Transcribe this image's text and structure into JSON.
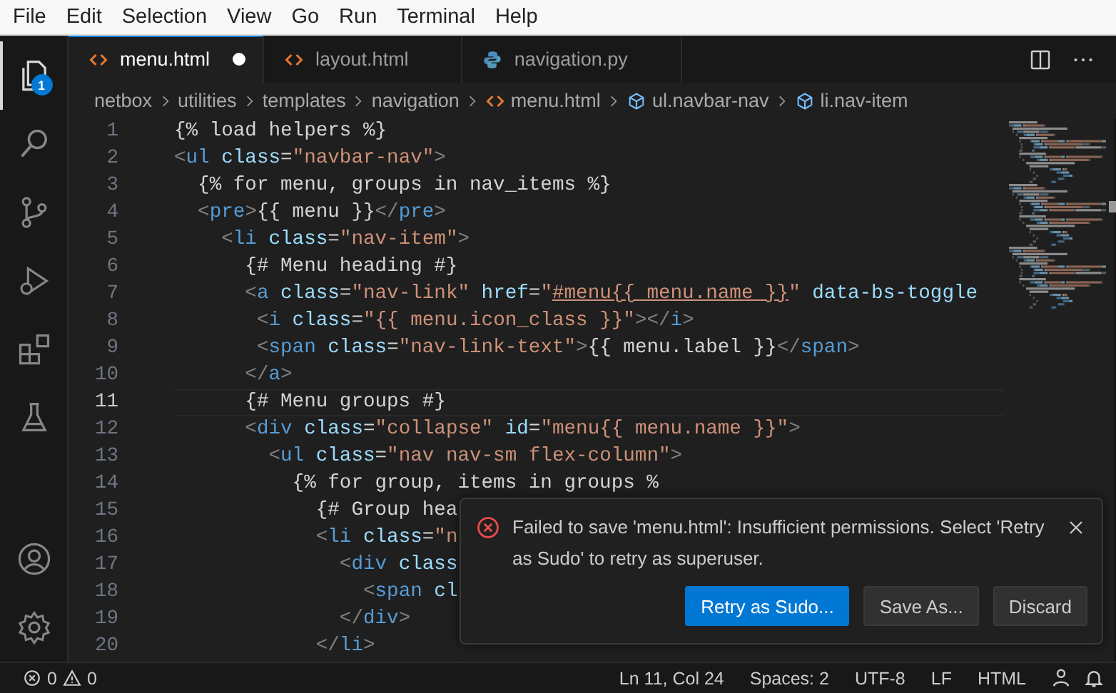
{
  "menu_bar": [
    "File",
    "Edit",
    "Selection",
    "View",
    "Go",
    "Run",
    "Terminal",
    "Help"
  ],
  "activity_bar": [
    {
      "kind": "explorer",
      "selected": true,
      "badge": "1"
    },
    {
      "kind": "search",
      "selected": false
    },
    {
      "kind": "source-control",
      "selected": false
    },
    {
      "kind": "run-debug",
      "selected": false
    },
    {
      "kind": "extensions",
      "selected": false
    },
    {
      "kind": "testing",
      "selected": false
    },
    {
      "kind": "account",
      "selected": false
    },
    {
      "kind": "settings",
      "selected": false
    }
  ],
  "tabs": [
    {
      "label": "menu.html",
      "kind": "html",
      "selected": true,
      "modified": true
    },
    {
      "label": "layout.html",
      "kind": "html",
      "selected": false,
      "modified": false
    },
    {
      "label": "navigation.py",
      "kind": "python",
      "selected": false,
      "modified": false
    }
  ],
  "breadcrumbs": [
    {
      "label": "netbox",
      "kind": "folder"
    },
    {
      "label": "utilities",
      "kind": "folder"
    },
    {
      "label": "templates",
      "kind": "folder"
    },
    {
      "label": "navigation",
      "kind": "folder"
    },
    {
      "label": "menu.html",
      "kind": "html"
    },
    {
      "label": "ul.navbar-nav",
      "kind": "symbol"
    },
    {
      "label": "li.nav-item",
      "kind": "symbol"
    }
  ],
  "editor": {
    "lines": [
      {
        "number": "1",
        "current": false,
        "tokens": [
          {
            "kind": "text",
            "text": "{% load helpers %}"
          }
        ]
      },
      {
        "number": "2",
        "current": false,
        "tokens": [
          {
            "kind": "punct",
            "text": "<"
          },
          {
            "kind": "tag",
            "text": "ul"
          },
          {
            "kind": "attr",
            "text": " class"
          },
          {
            "kind": "text",
            "text": "="
          },
          {
            "kind": "str",
            "text": "\"navbar-nav\""
          },
          {
            "kind": "punct",
            "text": ">"
          }
        ]
      },
      {
        "number": "3",
        "current": false,
        "tokens": [
          {
            "kind": "text",
            "text": "  {% for menu, groups in nav_items %}"
          }
        ]
      },
      {
        "number": "4",
        "current": false,
        "tokens": [
          {
            "kind": "punct",
            "text": "  <"
          },
          {
            "kind": "tag",
            "text": "pre"
          },
          {
            "kind": "punct",
            "text": ">"
          },
          {
            "kind": "text",
            "text": "{{ menu }}"
          },
          {
            "kind": "punct",
            "text": "</"
          },
          {
            "kind": "tag",
            "text": "pre"
          },
          {
            "kind": "punct",
            "text": ">"
          }
        ]
      },
      {
        "number": "5",
        "current": false,
        "tokens": [
          {
            "kind": "punct",
            "text": "    <"
          },
          {
            "kind": "tag",
            "text": "li"
          },
          {
            "kind": "attr",
            "text": " class"
          },
          {
            "kind": "text",
            "text": "="
          },
          {
            "kind": "str",
            "text": "\"nav-item\""
          },
          {
            "kind": "punct",
            "text": ">"
          }
        ]
      },
      {
        "number": "6",
        "current": false,
        "tokens": [
          {
            "kind": "text",
            "text": "      {# Menu heading #}"
          }
        ]
      },
      {
        "number": "7",
        "current": false,
        "tokens": [
          {
            "kind": "punct",
            "text": "      <"
          },
          {
            "kind": "tag",
            "text": "a"
          },
          {
            "kind": "attr",
            "text": " class"
          },
          {
            "kind": "text",
            "text": "="
          },
          {
            "kind": "str",
            "text": "\"nav-link\""
          },
          {
            "kind": "attr",
            "text": " href"
          },
          {
            "kind": "text",
            "text": "="
          },
          {
            "kind": "str",
            "text": "\""
          },
          {
            "kind": "link",
            "text": "#menu{{ menu.name }}"
          },
          {
            "kind": "str",
            "text": "\""
          },
          {
            "kind": "attr",
            "text": " data-bs-toggle"
          }
        ]
      },
      {
        "number": "8",
        "current": false,
        "tokens": [
          {
            "kind": "punct",
            "text": "       <"
          },
          {
            "kind": "tag",
            "text": "i"
          },
          {
            "kind": "attr",
            "text": " class"
          },
          {
            "kind": "text",
            "text": "="
          },
          {
            "kind": "str",
            "text": "\"{{ menu.icon_class }}\""
          },
          {
            "kind": "punct",
            "text": "></"
          },
          {
            "kind": "tag",
            "text": "i"
          },
          {
            "kind": "punct",
            "text": ">"
          }
        ]
      },
      {
        "number": "9",
        "current": false,
        "tokens": [
          {
            "kind": "punct",
            "text": "       <"
          },
          {
            "kind": "tag",
            "text": "span"
          },
          {
            "kind": "attr",
            "text": " class"
          },
          {
            "kind": "text",
            "text": "="
          },
          {
            "kind": "str",
            "text": "\"nav-link-text\""
          },
          {
            "kind": "punct",
            "text": ">"
          },
          {
            "kind": "text",
            "text": "{{ menu.label }}"
          },
          {
            "kind": "punct",
            "text": "</"
          },
          {
            "kind": "tag",
            "text": "span"
          },
          {
            "kind": "punct",
            "text": ">"
          }
        ]
      },
      {
        "number": "10",
        "current": false,
        "tokens": [
          {
            "kind": "punct",
            "text": "      </"
          },
          {
            "kind": "tag",
            "text": "a"
          },
          {
            "kind": "punct",
            "text": ">"
          }
        ]
      },
      {
        "number": "11",
        "current": true,
        "tokens": [
          {
            "kind": "text",
            "text": "      {# Menu groups #}"
          }
        ]
      },
      {
        "number": "12",
        "current": false,
        "tokens": [
          {
            "kind": "punct",
            "text": "      <"
          },
          {
            "kind": "tag",
            "text": "div"
          },
          {
            "kind": "attr",
            "text": " class"
          },
          {
            "kind": "text",
            "text": "="
          },
          {
            "kind": "str",
            "text": "\"collapse\""
          },
          {
            "kind": "attr",
            "text": " id"
          },
          {
            "kind": "text",
            "text": "="
          },
          {
            "kind": "str",
            "text": "\"menu{{ menu.name }}\""
          },
          {
            "kind": "punct",
            "text": ">"
          }
        ]
      },
      {
        "number": "13",
        "current": false,
        "tokens": [
          {
            "kind": "punct",
            "text": "        <"
          },
          {
            "kind": "tag",
            "text": "ul"
          },
          {
            "kind": "attr",
            "text": " class"
          },
          {
            "kind": "text",
            "text": "="
          },
          {
            "kind": "str",
            "text": "\"nav nav-sm flex-column\""
          },
          {
            "kind": "punct",
            "text": ">"
          }
        ]
      },
      {
        "number": "14",
        "current": false,
        "tokens": [
          {
            "kind": "text",
            "text": "          {% for group, items in groups %"
          }
        ]
      },
      {
        "number": "15",
        "current": false,
        "tokens": [
          {
            "kind": "text",
            "text": "            {# Group hea"
          }
        ]
      },
      {
        "number": "16",
        "current": false,
        "tokens": [
          {
            "kind": "punct",
            "text": "            <"
          },
          {
            "kind": "tag",
            "text": "li"
          },
          {
            "kind": "attr",
            "text": " class"
          },
          {
            "kind": "text",
            "text": "="
          },
          {
            "kind": "str",
            "text": "\"n"
          }
        ]
      },
      {
        "number": "17",
        "current": false,
        "tokens": [
          {
            "kind": "punct",
            "text": "              <"
          },
          {
            "kind": "tag",
            "text": "div"
          },
          {
            "kind": "attr",
            "text": " class"
          }
        ]
      },
      {
        "number": "18",
        "current": false,
        "tokens": [
          {
            "kind": "punct",
            "text": "                <"
          },
          {
            "kind": "tag",
            "text": "span"
          },
          {
            "kind": "attr",
            "text": " cl"
          }
        ]
      },
      {
        "number": "19",
        "current": false,
        "tokens": [
          {
            "kind": "punct",
            "text": "              </"
          },
          {
            "kind": "tag",
            "text": "div"
          },
          {
            "kind": "punct",
            "text": ">"
          }
        ]
      },
      {
        "number": "20",
        "current": false,
        "tokens": [
          {
            "kind": "punct",
            "text": "            </"
          },
          {
            "kind": "tag",
            "text": "li"
          },
          {
            "kind": "punct",
            "text": ">"
          }
        ]
      }
    ]
  },
  "notification": {
    "kind": "error",
    "message": "Failed to save 'menu.html': Insufficient permissions. Select 'Retry as Sudo' to retry as superuser.",
    "buttons": [
      {
        "label": "Retry as Sudo...",
        "primary": true
      },
      {
        "label": "Save As...",
        "primary": false
      },
      {
        "label": "Discard",
        "primary": false
      }
    ]
  },
  "status_bar": {
    "errors": "0",
    "warnings": "0",
    "items": [
      "Ln 11, Col 24",
      "Spaces: 2",
      "UTF-8",
      "LF",
      "HTML"
    ]
  }
}
